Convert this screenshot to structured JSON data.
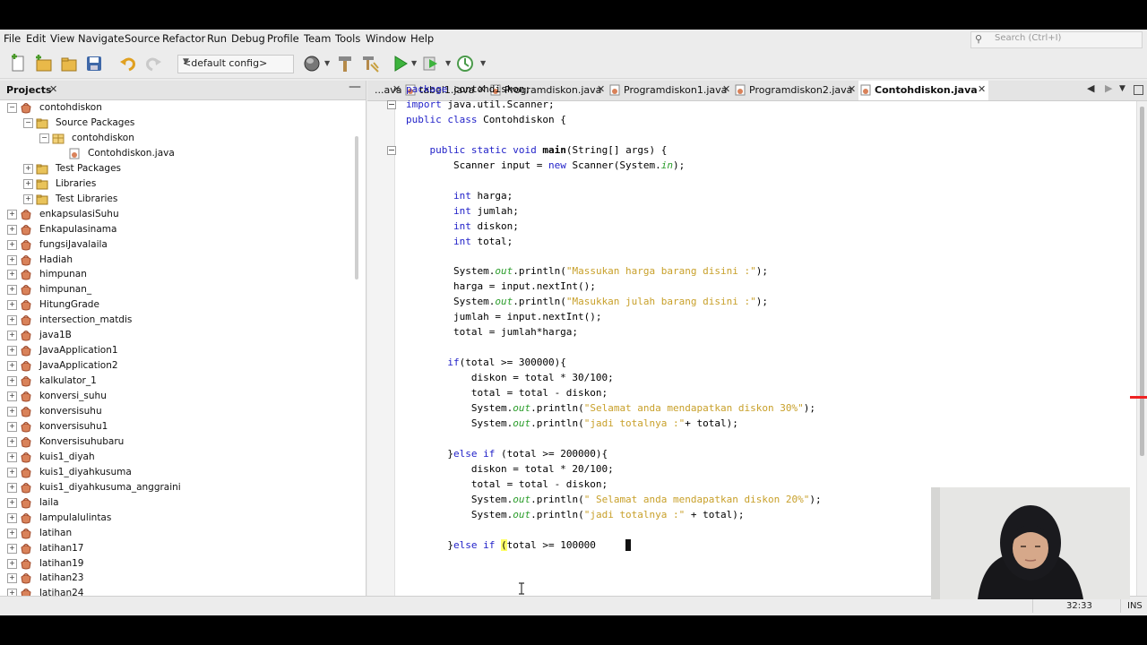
{
  "menu": [
    "File",
    "Edit",
    "View",
    "Navigate",
    "Source",
    "Refactor",
    "Run",
    "Debug",
    "Profile",
    "Team",
    "Tools",
    "Window",
    "Help"
  ],
  "search": {
    "placeholder": "Search (Ctrl+I)"
  },
  "toolbar": {
    "config": "<default config>"
  },
  "projects_panel": {
    "title": "Projects"
  },
  "tree": [
    {
      "label": "contohdiskon",
      "level": 0,
      "toggle": "−",
      "icon": "project-icon"
    },
    {
      "label": "Source Packages",
      "level": 1,
      "toggle": "−",
      "icon": "folder-icon"
    },
    {
      "label": "contohdiskon",
      "level": 2,
      "toggle": "−",
      "icon": "package-icon"
    },
    {
      "label": "Contohdiskon.java",
      "level": 3,
      "toggle": "",
      "icon": "java-file-icon"
    },
    {
      "label": "Test Packages",
      "level": 1,
      "toggle": "+",
      "icon": "folder-icon"
    },
    {
      "label": "Libraries",
      "level": 1,
      "toggle": "+",
      "icon": "folder-icon"
    },
    {
      "label": "Test Libraries",
      "level": 1,
      "toggle": "+",
      "icon": "folder-icon"
    },
    {
      "label": "enkapsulasiSuhu",
      "level": 0,
      "toggle": "+",
      "icon": "project-icon"
    },
    {
      "label": "Enkapulasinama",
      "level": 0,
      "toggle": "+",
      "icon": "project-icon"
    },
    {
      "label": "fungsiJavalaila",
      "level": 0,
      "toggle": "+",
      "icon": "project-icon"
    },
    {
      "label": "Hadiah",
      "level": 0,
      "toggle": "+",
      "icon": "project-icon"
    },
    {
      "label": "himpunan",
      "level": 0,
      "toggle": "+",
      "icon": "project-icon"
    },
    {
      "label": "himpunan_",
      "level": 0,
      "toggle": "+",
      "icon": "project-icon"
    },
    {
      "label": "HitungGrade",
      "level": 0,
      "toggle": "+",
      "icon": "project-icon"
    },
    {
      "label": "intersection_matdis",
      "level": 0,
      "toggle": "+",
      "icon": "project-icon"
    },
    {
      "label": "java1B",
      "level": 0,
      "toggle": "+",
      "icon": "project-icon"
    },
    {
      "label": "JavaApplication1",
      "level": 0,
      "toggle": "+",
      "icon": "project-icon"
    },
    {
      "label": "JavaApplication2",
      "level": 0,
      "toggle": "+",
      "icon": "project-icon"
    },
    {
      "label": "kalkulator_1",
      "level": 0,
      "toggle": "+",
      "icon": "project-icon"
    },
    {
      "label": "konversi_suhu",
      "level": 0,
      "toggle": "+",
      "icon": "project-icon"
    },
    {
      "label": "konversisuhu",
      "level": 0,
      "toggle": "+",
      "icon": "project-icon"
    },
    {
      "label": "konversisuhu1",
      "level": 0,
      "toggle": "+",
      "icon": "project-icon"
    },
    {
      "label": "Konversisuhubaru",
      "level": 0,
      "toggle": "+",
      "icon": "project-icon"
    },
    {
      "label": "kuis1_diyah",
      "level": 0,
      "toggle": "+",
      "icon": "project-icon"
    },
    {
      "label": "kuis1_diyahkusuma",
      "level": 0,
      "toggle": "+",
      "icon": "project-icon"
    },
    {
      "label": "kuis1_diyahkusuma_anggraini",
      "level": 0,
      "toggle": "+",
      "icon": "project-icon"
    },
    {
      "label": "laila",
      "level": 0,
      "toggle": "+",
      "icon": "project-icon"
    },
    {
      "label": "lampulalulintas",
      "level": 0,
      "toggle": "+",
      "icon": "project-icon"
    },
    {
      "label": "latihan",
      "level": 0,
      "toggle": "+",
      "icon": "project-icon"
    },
    {
      "label": "latihan17",
      "level": 0,
      "toggle": "+",
      "icon": "project-icon"
    },
    {
      "label": "latihan19",
      "level": 0,
      "toggle": "+",
      "icon": "project-icon"
    },
    {
      "label": "latihan23",
      "level": 0,
      "toggle": "+",
      "icon": "project-icon"
    },
    {
      "label": "latihan24",
      "level": 0,
      "toggle": "+",
      "icon": "project-icon"
    }
  ],
  "editor_tabs": [
    {
      "label": "...ava",
      "active": false
    },
    {
      "label": "tabel1.java",
      "active": false
    },
    {
      "label": "Programdiskon.java",
      "active": false
    },
    {
      "label": "Programdiskon1.java",
      "active": false
    },
    {
      "label": "Programdiskon2.java",
      "active": false
    },
    {
      "label": "Contohdiskon.java",
      "active": true
    }
  ],
  "code_lines": [
    "<span class=\"kw\">package</span> contohdiskon;",
    "<span class=\"kw\">import</span> java.util.Scanner;",
    "<span class=\"kw\">public class</span> Contohdiskon {",
    "",
    "    <span class=\"kw\">public static void</span> <span class=\"bd\">main</span>(String[] args) {",
    "        Scanner input = <span class=\"kw\">new</span> Scanner(System.<span class=\"sf\">in</span>);",
    "",
    "        <span class=\"kw\">int</span> harga;",
    "        <span class=\"kw\">int</span> jumlah;",
    "        <span class=\"kw\">int</span> diskon;",
    "        <span class=\"kw\">int</span> total;",
    "",
    "        System.<span class=\"sf\">out</span>.println(<span class=\"st\">\"Massukan harga barang disini :\"</span>);",
    "        harga = input.nextInt();",
    "        System.<span class=\"sf\">out</span>.println(<span class=\"st\">\"Masukkan julah barang disini :\"</span>);",
    "        jumlah = input.nextInt();",
    "        total = jumlah*harga;",
    "",
    "       <span class=\"kw\">if</span>(total &gt;= 300000){",
    "           diskon = total * 30/100;",
    "           total = total - diskon;",
    "           System.<span class=\"sf\">out</span>.println(<span class=\"st\">\"Selamat anda mendapatkan diskon 30%\"</span>);",
    "           System.<span class=\"sf\">out</span>.println(<span class=\"st\">\"jadi totalnya :\"</span>+ total);",
    "",
    "       }<span class=\"kw\">else if</span> (total &gt;= 200000){",
    "           diskon = total * 20/100;",
    "           total = total - diskon;",
    "           System.<span class=\"sf\">out</span>.println(<span class=\"st\">\" Selamat anda mendapatkan diskon 20%\"</span>);",
    "           System.<span class=\"sf\">out</span>.println(<span class=\"st\">\"jadi totalnya :\"</span> + total);",
    "",
    "       }<span class=\"kw\">else if</span> <span class=\"hl\">(</span>total &gt;= 100000"
  ],
  "status": {
    "position": "32:33",
    "mode": "INS"
  },
  "colors": {
    "keyword": "#1f1fc8",
    "string": "#c8a02a",
    "static_field": "#2b9d2b",
    "bracket_highlight": "#ffff66",
    "error_mark": "#ee2222"
  }
}
